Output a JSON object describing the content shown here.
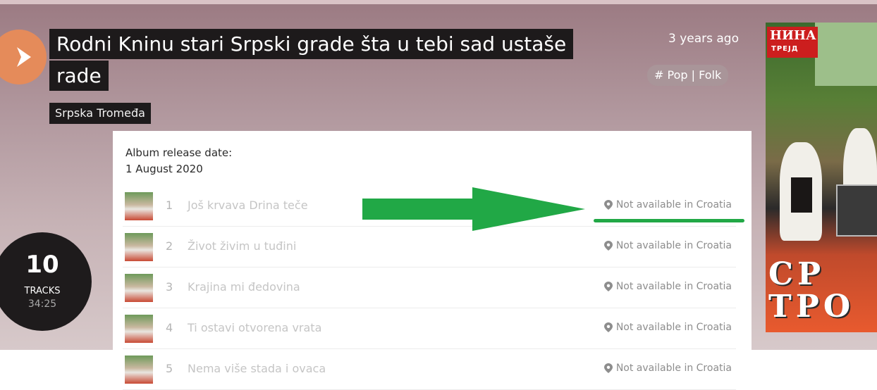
{
  "album": {
    "title_line1": "Rodni Kninu stari Srpski grade šta u tebi sad ustaše",
    "title_line2": "rade",
    "artist": "Srpska Tromeđa",
    "time_ago": "3 years ago",
    "genre": "# Pop | Folk",
    "release_label": "Album release date:",
    "release_date": "1 August 2020"
  },
  "stats": {
    "track_count": "10",
    "tracks_label": "TRACKS",
    "duration": "34:25"
  },
  "cover": {
    "logo_text": "НИНА",
    "logo_sub": "ТРЕЈД",
    "title_line1": "СР",
    "title_line2": "ТРО"
  },
  "tracks": [
    {
      "number": "1",
      "title": "Još krvava Drina teče",
      "availability": "Not available in Croatia"
    },
    {
      "number": "2",
      "title": "Život živim u tuđini",
      "availability": "Not available in Croatia"
    },
    {
      "number": "3",
      "title": "Krajina mi đedovina",
      "availability": "Not available in Croatia"
    },
    {
      "number": "4",
      "title": "Ti ostavi otvorena vrata",
      "availability": "Not available in Croatia"
    },
    {
      "number": "5",
      "title": "Nema više stada i ovaca",
      "availability": "Not available in Croatia"
    }
  ],
  "colors": {
    "play_button": "#e58b5a",
    "annotation_green": "#21a846",
    "title_bg": "#1d1a1b"
  },
  "icons": [
    "play-icon",
    "location-pin-icon",
    "annotation-arrow-icon"
  ]
}
